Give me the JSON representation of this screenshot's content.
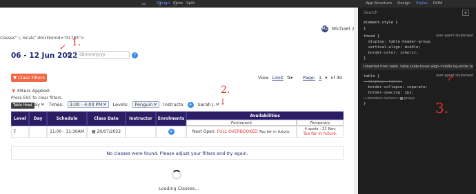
{
  "topbar": {
    "modes": [
      "Design",
      "Code",
      "Split"
    ],
    "active_mode": "Design",
    "right_tabs": [
      "App Structure",
      "Design",
      "Styles",
      "DOM"
    ],
    "active_right": "Styles"
  },
  "code_line": "classes\" ), locals\" dmxDomId=\"d1785\">",
  "user": {
    "initials": "MZ",
    "name": "Michael Z."
  },
  "date_range": "06 - 12 Jun 2022",
  "date_placeholder": "dd/mm/yyyy",
  "help_glyph": "?",
  "view": {
    "label": "View",
    "limit": "Limit"
  },
  "pagination": {
    "page_label": "Page:",
    "page": "1",
    "of": "of 49"
  },
  "filters": {
    "button": "Class Filters",
    "applied_label": "Filters Applied:",
    "esc_hint": "Press ESC to clear filters.",
    "tooltip": "Table Head",
    "day_chip": "day",
    "times_label": "Times:",
    "times_value": "3:00 - 4:00 PM",
    "levels_label": "Levels:",
    "levels_value": "Penguin",
    "instructor_label": "Instructo",
    "instructor_value": "Sarah J."
  },
  "table": {
    "headers": [
      "Level",
      "Day",
      "Schedule",
      "Class Date",
      "Instructor",
      "Enrolments",
      "Availabilities"
    ],
    "sub_headers": [
      "Permanent",
      "Temporary"
    ],
    "row": {
      "level": "F",
      "day": "",
      "schedule": "11:00 - 11:30AM",
      "class_date": "20/07/2022",
      "instructor": "",
      "next_open": "Next Open:",
      "status": "FULL OVERBOOKED",
      "too_far": "Too far in future.",
      "spots": "4 spots - 21 Nov",
      "temp_too_far": "Too far in future."
    }
  },
  "no_classes": "No classes were found. Please adjust your filters and try again.",
  "loading": "Loading Classes...",
  "styles": {
    "search": "Search",
    "selector": "element.style {",
    "close": "}",
    "thead_rule": "thead {\n  display: table-header-group;\n  vertical-align: middle;\n  border-color: inherit;\n}",
    "ua1": "user agent stylesheet",
    "inherited": "Inherited from  table .table.table-hover.align-middle.bg-white.table...",
    "table_rule_start": "table {",
    "display_struck": "  display: table;",
    "collapse": "  border-collapse: separate;",
    "spacing": "  border-spacing: 2px;",
    "color_struck": "  border-color: ",
    "color_val": "gray;",
    "ua2": "user agent stylesheet"
  },
  "annotations": [
    "1.",
    "2.",
    "3."
  ]
}
